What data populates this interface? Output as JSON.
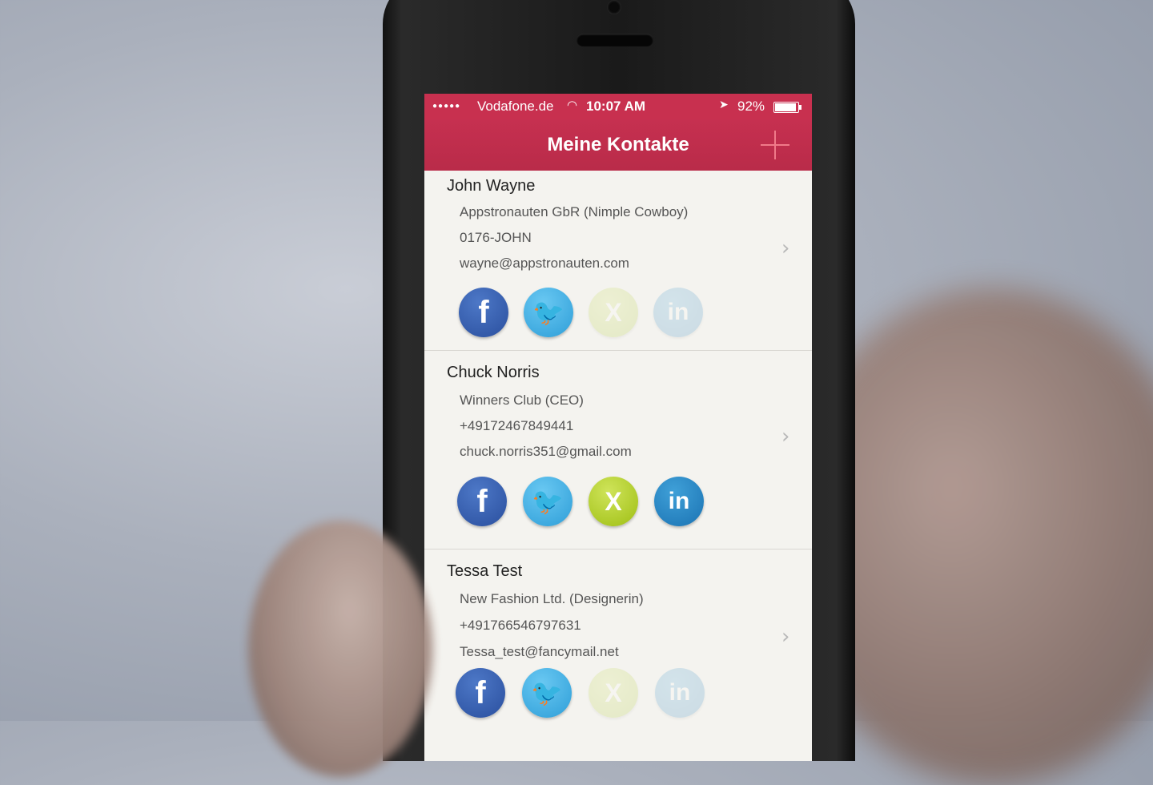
{
  "status_bar": {
    "carrier": "Vodafone.de",
    "time": "10:07 AM",
    "battery": "92%",
    "battery_level": 0.92,
    "signal_dots": "●●●●●"
  },
  "nav": {
    "title": "Meine Kontakte"
  },
  "contacts": [
    {
      "name": "John Wayne",
      "company": "Appstronauten GbR (Nimple Cowboy)",
      "phone": "0176-JOHN",
      "email": "wayne@appstronauten.com",
      "networks_active": [
        "facebook",
        "twitter"
      ],
      "networks_inactive": [
        "xing",
        "linkedin"
      ]
    },
    {
      "name": "Chuck Norris",
      "company": "Winners Club (CEO)",
      "phone": "+49172467849441",
      "email": "chuck.norris351@gmail.com",
      "networks_active": [
        "facebook",
        "twitter",
        "xing",
        "linkedin"
      ],
      "networks_inactive": []
    },
    {
      "name": "Tessa Test",
      "company": "New Fashion Ltd. (Designerin)",
      "phone": "+491766546797631",
      "email": "Tessa_test@fancymail.net",
      "networks_active": [
        "facebook",
        "twitter"
      ],
      "networks_inactive": [
        "xing",
        "linkedin"
      ]
    }
  ],
  "icons": {
    "facebook": "f",
    "twitter": "🐦",
    "xing": "X",
    "linkedin": "in",
    "chevron": "›",
    "wifi": "◠",
    "location": "➤"
  },
  "colors": {
    "accent": "#c8304f",
    "facebook": "#2f57a8",
    "twitter": "#3aa9e0",
    "xing": "#b6d024",
    "linkedin": "#2485c6"
  }
}
